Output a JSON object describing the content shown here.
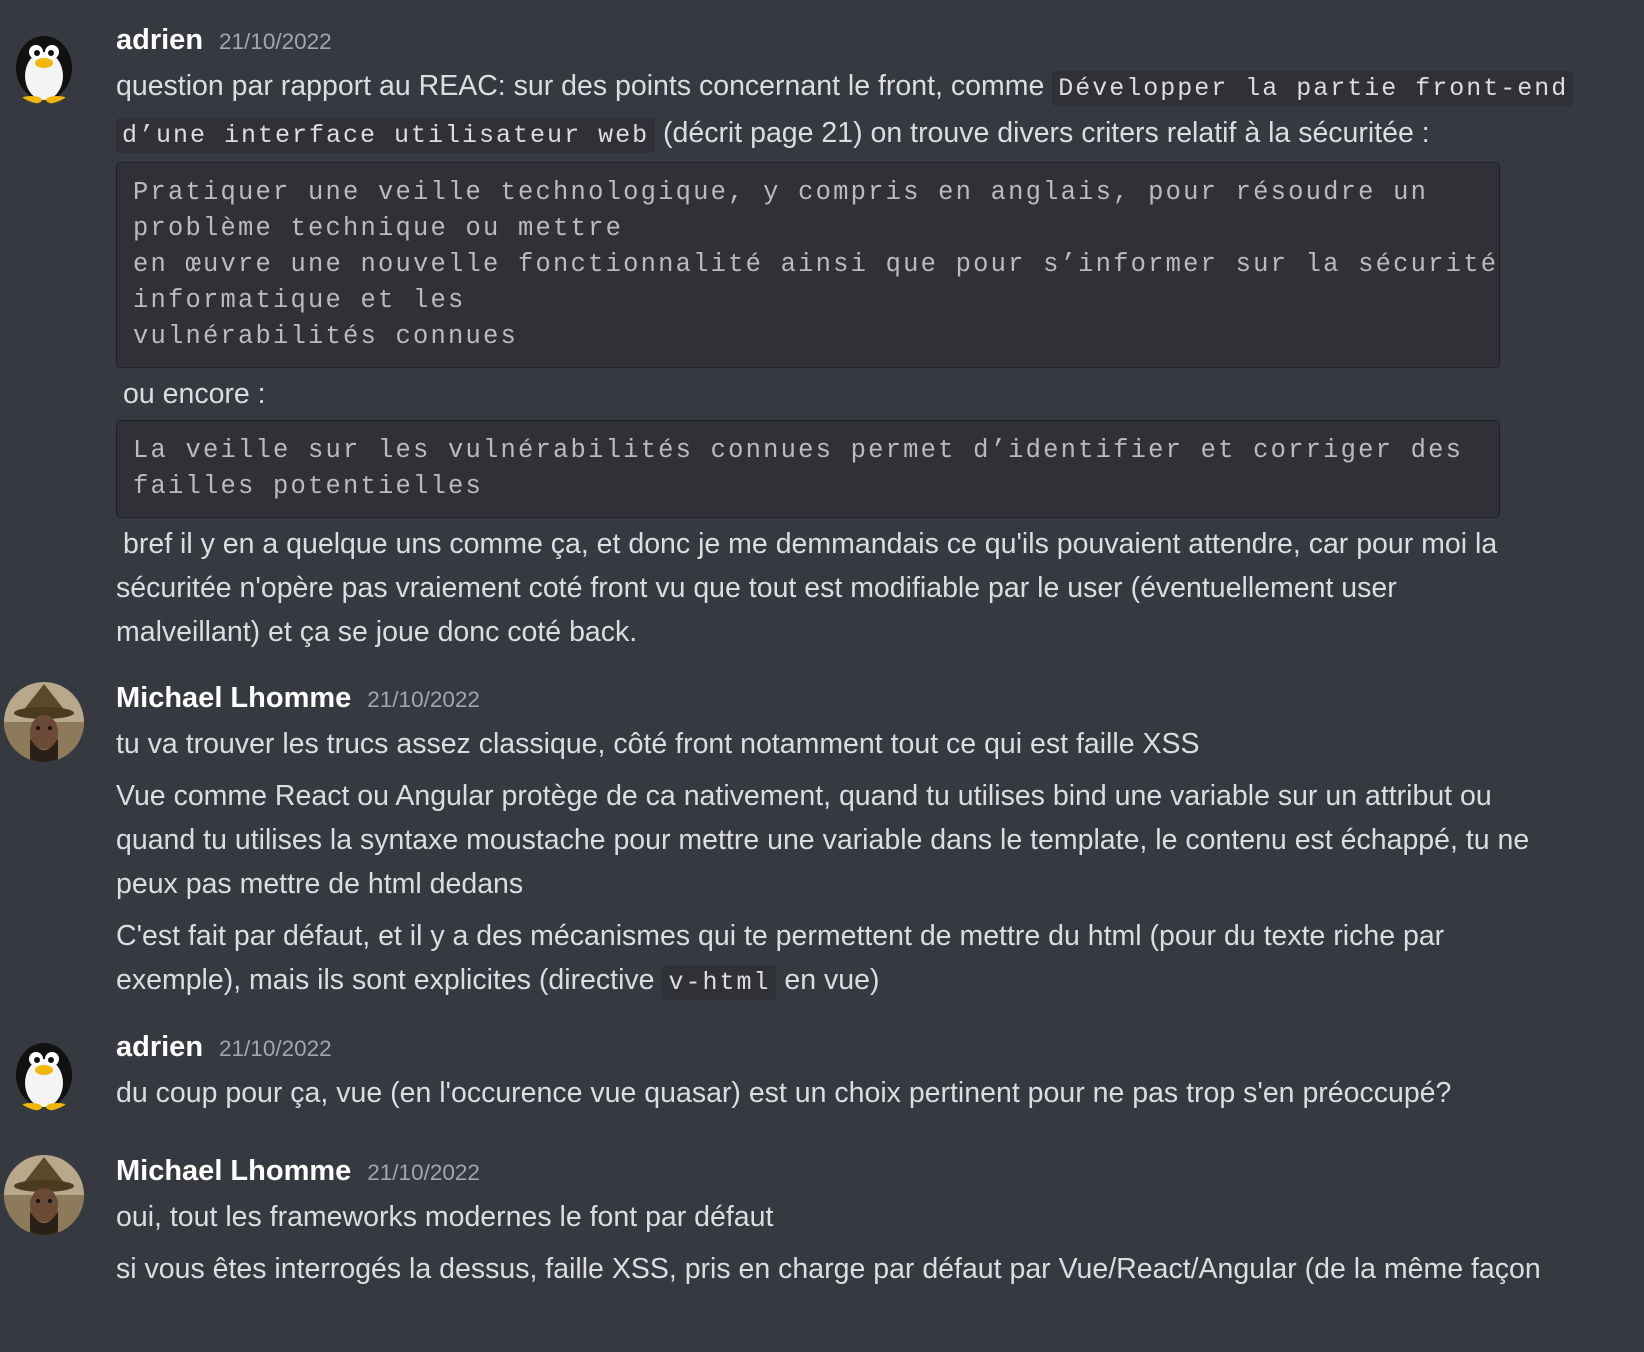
{
  "messages": [
    {
      "author": "adrien",
      "timestamp": "21/10/2022",
      "avatar_icon": "tux-penguin-icon",
      "content": {
        "p1_text_a": "question par rapport au REAC: sur des points concernant le front, comme ",
        "p1_code_a": "Développer la partie front-end",
        "p1_code_b": "d’une interface utilisateur web",
        "p1_text_b": " (décrit page 21) on trouve divers criters relatif à la sécuritée :",
        "code_block_1": "Pratiquer une veille technologique, y compris en anglais, pour résoudre un\nproblème technique ou mettre\nen œuvre une nouvelle fonctionnalité ainsi que pour s’informer sur la sécurité\ninformatique et les\nvulnérabilités connues",
        "p2_text": "ou encore :",
        "code_block_2": "La veille sur les vulnérabilités connues permet d’identifier et corriger des\nfailles potentielles",
        "p3_line1": "bref il y en a quelque uns comme ça, et donc je me demmandais ce qu'ils pouvaient attendre, car pour moi la",
        "p3_line2": "sécuritée n'opère pas vraiement coté front vu que tout est modifiable par le user (éventuellement user",
        "p3_line3": "malveillant) et ça se joue donc coté back."
      }
    },
    {
      "author": "Michael Lhomme",
      "timestamp": "21/10/2022",
      "avatar_icon": "wizard-hat-avatar-icon",
      "content": {
        "l1": "tu va trouver les trucs assez classique, côté front notamment tout ce qui est faille XSS",
        "l2a": "Vue comme React ou Angular protège de ca nativement, quand tu utilises bind une variable sur un attribut ou",
        "l2b": "quand tu utilises la syntaxe moustache pour mettre une variable dans le template, le contenu est échappé, tu ne",
        "l2c": "peux pas mettre de html dedans",
        "l3a": "C'est fait par défaut, et il y a des mécanismes qui te permettent de mettre du html (pour du texte riche par",
        "l3b_text_a": "exemple), mais ils sont explicites (directive ",
        "l3b_code": "v-html",
        "l3b_text_b": " en vue)"
      }
    },
    {
      "author": "adrien",
      "timestamp": "21/10/2022",
      "avatar_icon": "tux-penguin-icon",
      "content": {
        "l1": "du coup pour ça, vue (en l'occurence vue quasar) est un choix pertinent pour ne pas trop s'en préoccupé?"
      }
    },
    {
      "author": "Michael Lhomme",
      "timestamp": "21/10/2022",
      "avatar_icon": "wizard-hat-avatar-icon",
      "content": {
        "l1": "oui, tout les frameworks modernes le font par défaut",
        "l2": "si vous êtes interrogés la dessus, faille XSS, pris en charge par défaut par Vue/React/Angular (de la même façon"
      }
    }
  ],
  "colors": {
    "background": "#36393f",
    "author": "#ffffff",
    "timestamp": "#a3a6aa",
    "text": "#dcddde",
    "code_bg": "#2f3136"
  }
}
